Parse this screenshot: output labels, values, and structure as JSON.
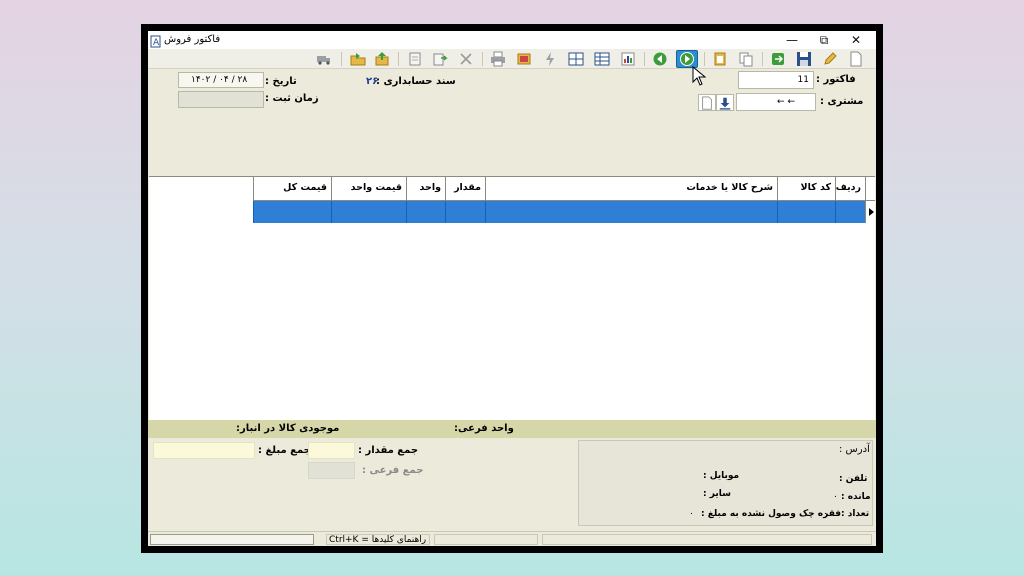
{
  "window": {
    "title": "فاکتور فروش",
    "controls": {
      "minimize": "—",
      "maximize": "⧉",
      "close": "✕"
    }
  },
  "toolbar": {
    "icons": [
      "truck-icon",
      "folder-open-icon",
      "export-icon",
      "copy-doc-icon",
      "doc-forward-icon",
      "delete-icon",
      "print-icon",
      "report-icon",
      "bolt-icon",
      "grid-icon",
      "table-icon",
      "chart-icon",
      "back-icon",
      "forward-icon",
      "paste-icon",
      "copy-icon",
      "exit-green-icon",
      "save-icon",
      "edit-icon",
      "new-icon"
    ]
  },
  "form": {
    "invoice_label": "فاکتور :",
    "invoice_value": "11",
    "customer_label": "مشتری :",
    "customer_value": "←     ←",
    "accounting_doc_label": "سند حسابداری :",
    "accounting_doc_value": "۲۶",
    "date_label": "تاریخ :",
    "date_value": "۱۴۰۲ / ۰۴ / ۲۸",
    "register_time_label": "زمان ثبت :",
    "register_time_value": ""
  },
  "grid": {
    "columns": [
      "ردیف",
      "کد کالا",
      "شرح کالا یا خدمات",
      "مقدار",
      "واحد",
      "قیمت واحد",
      "قیمت کل"
    ]
  },
  "bottom": {
    "stock_label": "موجودی کالا در انبار:",
    "sub_unit_label": "واحد فرعی:",
    "total_amount_label": "جمع مبلغ :",
    "total_amount_value": "",
    "total_qty_label": "جمع مقدار :",
    "total_qty_value": "",
    "total_sub_label": "جمع فرعی :",
    "total_sub_value": ""
  },
  "address_panel": {
    "address_label": "آدرس :",
    "phone_label": "تلفن :",
    "mobile_label": "موبایل :",
    "balance_label": "مانده :",
    "balance_value": "۰",
    "other_label": "سایر :",
    "count_label": "تعداد :",
    "count_value": "۰",
    "cheque_text": "فقره چک وصول نشده به مبلغ :",
    "cheque_value": "۰"
  },
  "statusbar": {
    "hint": "Ctrl+K = راهنمای کلیدها"
  },
  "colors": {
    "window_bg": "#ebeadb",
    "selected_row": "#2f7fd6",
    "strip": "#d6d7a8"
  }
}
